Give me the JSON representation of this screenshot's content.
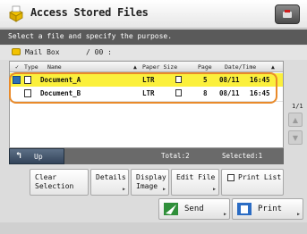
{
  "title": "Access Stored Files",
  "instruction": "Select a file and specify the purpose.",
  "mailbox": {
    "label": "Mail Box",
    "value": "/ 00 :"
  },
  "columns": {
    "type": "Type",
    "name": "Name",
    "paper": "Paper Size",
    "page": "Page",
    "datetime": "Date/Time"
  },
  "files": [
    {
      "name": "Document_A",
      "paper": "LTR",
      "pages": "5",
      "date": "08/11",
      "time": "16:45",
      "selected": true
    },
    {
      "name": "Document_B",
      "paper": "LTR",
      "pages": "8",
      "date": "08/11",
      "time": "16:45",
      "selected": false
    }
  ],
  "up_label": "Up",
  "total": "Total:2",
  "selected_count": "Selected:1",
  "page_indicator": "1/1",
  "buttons": {
    "clear": [
      "Clear",
      "Selection"
    ],
    "details": "Details",
    "display": [
      "Display",
      "Image"
    ],
    "edit": "Edit File",
    "print_list": "Print List",
    "send": "Send",
    "print": "Print"
  },
  "colors": {
    "highlight": "#e98a2a",
    "selected_row": "#fbf03c"
  }
}
